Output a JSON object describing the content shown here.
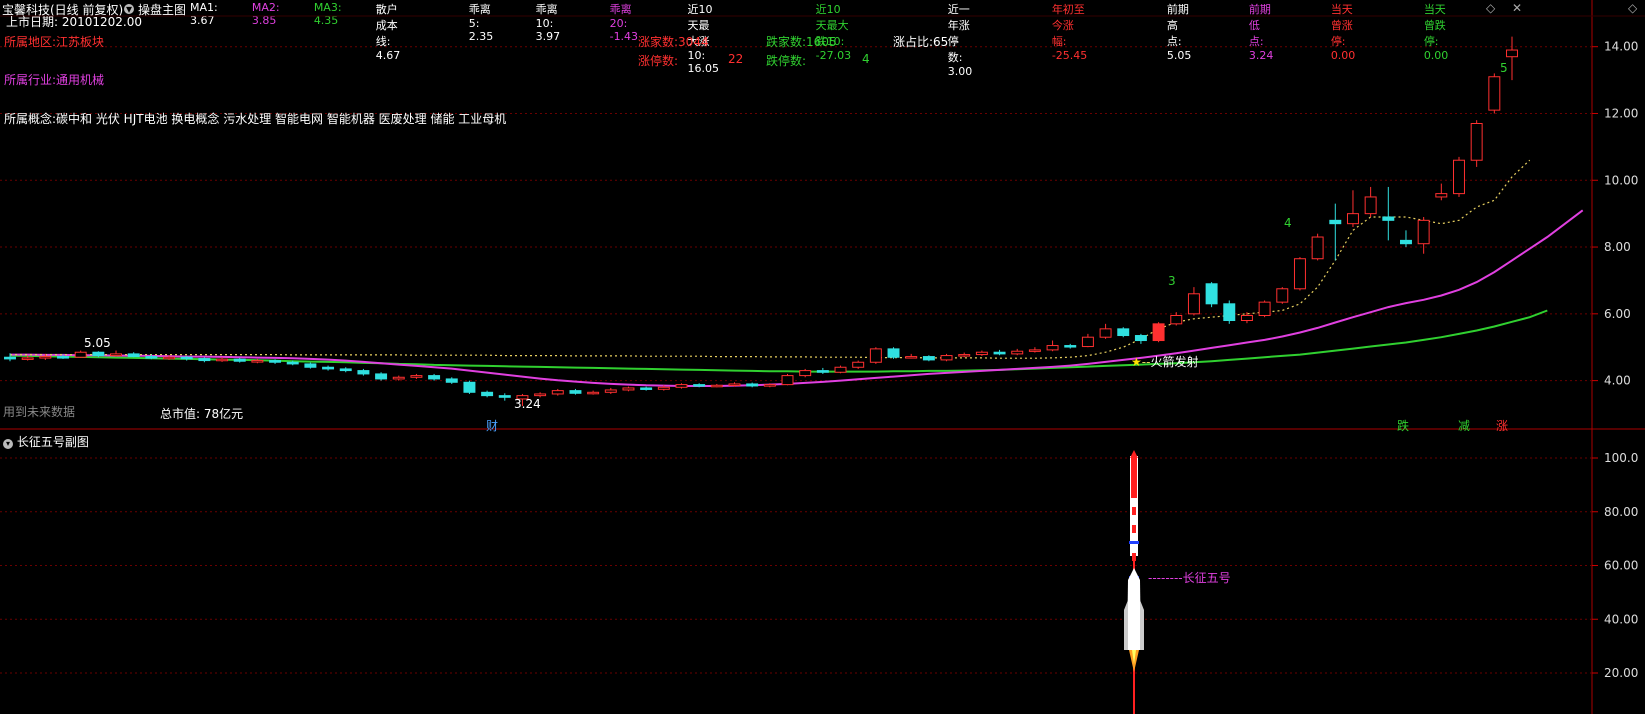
{
  "header": {
    "stock": "宝馨科技(日线 前复权)",
    "panel_name": "操盘主图",
    "indicators": [
      {
        "label": "MA1: 3.67",
        "color": "#ffffff"
      },
      {
        "label": "MA2: 3.85",
        "color": "#e040e0"
      },
      {
        "label": "MA3: 4.35",
        "color": "#30d030"
      },
      {
        "label": "散户成本线: 4.67",
        "color": "#ffffff"
      },
      {
        "label": "乖离5: 2.35",
        "color": "#ffffff"
      },
      {
        "label": "乖离10: 3.97",
        "color": "#ffffff"
      },
      {
        "label": "乖离20: -1.43",
        "color": "#e040e0"
      },
      {
        "label": "近10天最大涨10: 16.05",
        "color": "#ffffff"
      },
      {
        "label": "近10天最大跌10: -27.03",
        "color": "#30d030"
      },
      {
        "label": "近一年涨停数: 3.00",
        "color": "#ffffff"
      },
      {
        "label": "年初至今涨幅: -25.45",
        "color": "#ff3030"
      },
      {
        "label": "前期高点: 5.05",
        "color": "#ffffff"
      },
      {
        "label": "前期低点: 3.24",
        "color": "#e040e0"
      },
      {
        "label": "当天曾涨停: 0.00",
        "color": "#ff3030"
      },
      {
        "label": "当天曾跌停: 0.00",
        "color": "#30d030"
      }
    ]
  },
  "info": {
    "listing_date": "上市日期: 20101202.00",
    "region": "所属地区:江苏板块",
    "industry": "所属行业:通用机械",
    "concepts": "所属概念:碳中和 光伏 HJT电池 换电概念 污水处理 智能电网 智能机器 医废处理 储能 工业母机",
    "future_data": "用到未来数据",
    "market_cap": "总市值: 78亿元"
  },
  "stats": {
    "up_count": "涨家数:3044",
    "down_count": "跌家数:1605",
    "up_ratio": "涨占比:65",
    "limit_up_label": "涨停数:",
    "limit_up_value": "22",
    "limit_down_label": "跌停数:",
    "limit_down_value": "4"
  },
  "annotations": {
    "prev_high": "5.05",
    "prev_low": "3.24",
    "rocket_launch": "火箭发射",
    "cai": "财",
    "die": "跌",
    "jian": "减",
    "zhang": "涨",
    "count3": "3",
    "count4": "4",
    "count5": "5"
  },
  "price_axis": [
    "14.00",
    "12.00",
    "10.00",
    "8.00",
    "6.00",
    "4.00"
  ],
  "sub_panel": {
    "title": "长征五号副图",
    "rocket_label": "长征五号",
    "axis": [
      "100.0",
      "80.00",
      "60.00",
      "40.00",
      "20.00"
    ]
  },
  "colors": {
    "up": "#ff3030",
    "down": "#30e0e0",
    "ma2": "#e040e0",
    "ma3": "#30d030",
    "cost_line": "#e8d060",
    "grid": "#6a0000"
  },
  "chart_data": {
    "type": "candlestick",
    "ylim": [
      3.0,
      14.5
    ],
    "candles": [
      [
        4.7,
        4.65,
        4.82,
        4.58
      ],
      [
        4.65,
        4.68,
        4.75,
        4.6
      ],
      [
        4.68,
        4.72,
        4.8,
        4.62
      ],
      [
        4.72,
        4.7,
        4.78,
        4.65
      ],
      [
        4.7,
        4.85,
        4.9,
        4.68
      ],
      [
        4.85,
        4.75,
        4.88,
        4.7
      ],
      [
        4.75,
        4.8,
        4.9,
        4.72
      ],
      [
        4.8,
        4.72,
        4.85,
        4.7
      ],
      [
        4.72,
        4.68,
        4.78,
        4.64
      ],
      [
        4.68,
        4.7,
        4.76,
        4.62
      ],
      [
        4.7,
        4.66,
        4.74,
        4.6
      ],
      [
        4.66,
        4.6,
        4.7,
        4.55
      ],
      [
        4.6,
        4.64,
        4.7,
        4.56
      ],
      [
        4.64,
        4.58,
        4.68,
        4.54
      ],
      [
        4.58,
        4.6,
        4.65,
        4.52
      ],
      [
        4.6,
        4.55,
        4.64,
        4.5
      ],
      [
        4.55,
        4.5,
        4.6,
        4.46
      ],
      [
        4.5,
        4.4,
        4.54,
        4.36
      ],
      [
        4.4,
        4.35,
        4.45,
        4.3
      ],
      [
        4.35,
        4.3,
        4.4,
        4.25
      ],
      [
        4.3,
        4.2,
        4.35,
        4.15
      ],
      [
        4.2,
        4.05,
        4.25,
        4.0
      ],
      [
        4.05,
        4.1,
        4.15,
        4.0
      ],
      [
        4.1,
        4.15,
        4.2,
        4.05
      ],
      [
        4.15,
        4.05,
        4.2,
        4.0
      ],
      [
        4.05,
        3.95,
        4.1,
        3.9
      ],
      [
        3.95,
        3.65,
        4.0,
        3.6
      ],
      [
        3.65,
        3.55,
        3.7,
        3.5
      ],
      [
        3.55,
        3.5,
        3.62,
        3.4
      ],
      [
        3.45,
        3.55,
        3.6,
        3.24
      ],
      [
        3.55,
        3.6,
        3.65,
        3.5
      ],
      [
        3.6,
        3.7,
        3.75,
        3.55
      ],
      [
        3.7,
        3.62,
        3.75,
        3.58
      ],
      [
        3.62,
        3.65,
        3.7,
        3.58
      ],
      [
        3.65,
        3.72,
        3.78,
        3.6
      ],
      [
        3.72,
        3.78,
        3.82,
        3.68
      ],
      [
        3.78,
        3.74,
        3.82,
        3.7
      ],
      [
        3.74,
        3.8,
        3.86,
        3.7
      ],
      [
        3.8,
        3.88,
        3.92,
        3.76
      ],
      [
        3.88,
        3.84,
        3.92,
        3.8
      ],
      [
        3.84,
        3.86,
        3.9,
        3.8
      ],
      [
        3.86,
        3.9,
        3.95,
        3.82
      ],
      [
        3.9,
        3.84,
        3.94,
        3.8
      ],
      [
        3.84,
        3.88,
        3.92,
        3.8
      ],
      [
        3.88,
        4.15,
        4.2,
        3.86
      ],
      [
        4.15,
        4.3,
        4.35,
        4.1
      ],
      [
        4.3,
        4.25,
        4.38,
        4.2
      ],
      [
        4.25,
        4.4,
        4.45,
        4.22
      ],
      [
        4.4,
        4.55,
        4.6,
        4.35
      ],
      [
        4.55,
        4.95,
        5.0,
        4.5
      ],
      [
        4.95,
        4.7,
        5.0,
        4.65
      ],
      [
        4.7,
        4.72,
        4.8,
        4.66
      ],
      [
        4.72,
        4.62,
        4.76,
        4.58
      ],
      [
        4.62,
        4.75,
        4.8,
        4.58
      ],
      [
        4.75,
        4.78,
        4.84,
        4.7
      ],
      [
        4.78,
        4.85,
        4.9,
        4.74
      ],
      [
        4.85,
        4.8,
        4.92,
        4.76
      ],
      [
        4.8,
        4.88,
        4.95,
        4.76
      ],
      [
        4.88,
        4.92,
        5.0,
        4.84
      ],
      [
        4.92,
        5.05,
        5.2,
        4.88
      ],
      [
        5.05,
        5.02,
        5.1,
        4.96
      ],
      [
        5.02,
        5.3,
        5.4,
        5.0
      ],
      [
        5.3,
        5.55,
        5.7,
        5.25
      ],
      [
        5.55,
        5.35,
        5.6,
        5.3
      ],
      [
        5.35,
        5.2,
        5.4,
        5.1
      ],
      [
        5.2,
        5.7,
        5.75,
        5.15
      ],
      [
        5.7,
        5.95,
        6.05,
        5.65
      ],
      [
        6.0,
        6.6,
        6.8,
        5.95
      ],
      [
        6.9,
        6.3,
        6.95,
        6.2
      ],
      [
        6.3,
        5.8,
        6.4,
        5.7
      ],
      [
        5.8,
        5.95,
        6.05,
        5.72
      ],
      [
        5.95,
        6.35,
        6.4,
        5.9
      ],
      [
        6.35,
        6.75,
        6.8,
        6.3
      ],
      [
        6.75,
        7.65,
        7.7,
        6.7
      ],
      [
        7.65,
        8.3,
        8.4,
        7.6
      ],
      [
        8.8,
        8.7,
        9.3,
        7.6
      ],
      [
        8.7,
        9.0,
        9.7,
        8.6
      ],
      [
        9.0,
        9.5,
        9.8,
        8.9
      ],
      [
        8.9,
        8.8,
        9.8,
        8.2
      ],
      [
        8.2,
        8.1,
        8.5,
        8.0
      ],
      [
        8.1,
        8.8,
        8.9,
        7.8
      ],
      [
        9.5,
        9.6,
        9.9,
        9.4
      ],
      [
        9.6,
        10.6,
        10.7,
        9.5
      ],
      [
        10.6,
        11.7,
        11.8,
        10.4
      ],
      [
        12.1,
        13.1,
        13.2,
        12.0
      ],
      [
        13.7,
        13.9,
        14.3,
        13.0
      ]
    ],
    "cost_line": [
      4.78,
      4.78,
      4.78,
      4.78,
      4.78,
      4.78,
      4.78,
      4.78,
      4.78,
      4.78,
      4.78,
      4.78,
      4.78,
      4.78,
      4.78,
      4.78,
      4.77,
      4.77,
      4.77,
      4.77,
      4.77,
      4.77,
      4.77,
      4.76,
      4.76,
      4.76,
      4.76,
      4.76,
      4.75,
      4.75,
      4.75,
      4.75,
      4.74,
      4.74,
      4.74,
      4.74,
      4.73,
      4.73,
      4.73,
      4.73,
      4.72,
      4.72,
      4.72,
      4.71,
      4.71,
      4.71,
      4.7,
      4.7,
      4.7,
      4.69,
      4.69,
      4.69,
      4.68,
      4.68,
      4.68,
      4.68,
      4.67,
      4.67,
      4.67,
      4.68,
      4.7,
      4.75,
      4.85,
      5.0,
      5.25,
      5.55,
      5.75,
      5.85,
      5.9,
      5.95,
      6.0,
      6.05,
      6.1,
      6.3,
      6.8,
      7.6,
      8.5,
      8.9,
      8.9,
      8.9,
      8.8,
      8.7,
      8.8,
      9.2,
      9.4,
      10.1,
      10.6
    ],
    "ma2_line": [
      4.78,
      4.78,
      4.77,
      4.77,
      4.76,
      4.76,
      4.75,
      4.75,
      4.74,
      4.73,
      4.72,
      4.72,
      4.71,
      4.7,
      4.69,
      4.68,
      4.67,
      4.65,
      4.63,
      4.6,
      4.56,
      4.52,
      4.48,
      4.44,
      4.4,
      4.36,
      4.3,
      4.24,
      4.18,
      4.12,
      4.06,
      4.01,
      3.97,
      3.93,
      3.9,
      3.88,
      3.86,
      3.85,
      3.84,
      3.84,
      3.84,
      3.85,
      3.86,
      3.88,
      3.9,
      3.93,
      3.96,
      4.0,
      4.04,
      4.08,
      4.12,
      4.16,
      4.2,
      4.23,
      4.26,
      4.29,
      4.32,
      4.35,
      4.38,
      4.41,
      4.45,
      4.5,
      4.56,
      4.62,
      4.68,
      4.75,
      4.82,
      4.9,
      4.98,
      5.06,
      5.14,
      5.22,
      5.32,
      5.44,
      5.58,
      5.74,
      5.9,
      6.05,
      6.2,
      6.32,
      6.42,
      6.55,
      6.72,
      6.95,
      7.25,
      7.6,
      7.95,
      8.3,
      8.7,
      9.1
    ],
    "ma3_line": [
      4.75,
      4.74,
      4.73,
      4.72,
      4.71,
      4.7,
      4.69,
      4.68,
      4.67,
      4.66,
      4.65,
      4.64,
      4.63,
      4.62,
      4.61,
      4.6,
      4.58,
      4.57,
      4.56,
      4.55,
      4.53,
      4.52,
      4.5,
      4.49,
      4.47,
      4.46,
      4.45,
      4.44,
      4.43,
      4.42,
      4.41,
      4.4,
      4.39,
      4.38,
      4.37,
      4.36,
      4.35,
      4.34,
      4.33,
      4.32,
      4.31,
      4.3,
      4.29,
      4.28,
      4.28,
      4.27,
      4.27,
      4.27,
      4.27,
      4.27,
      4.28,
      4.28,
      4.29,
      4.29,
      4.3,
      4.31,
      4.32,
      4.34,
      4.36,
      4.38,
      4.4,
      4.42,
      4.44,
      4.46,
      4.48,
      4.5,
      4.52,
      4.55,
      4.58,
      4.62,
      4.66,
      4.7,
      4.74,
      4.78,
      4.84,
      4.9,
      4.96,
      5.02,
      5.08,
      5.14,
      5.22,
      5.3,
      5.4,
      5.5,
      5.62,
      5.76,
      5.9,
      6.1
    ]
  }
}
